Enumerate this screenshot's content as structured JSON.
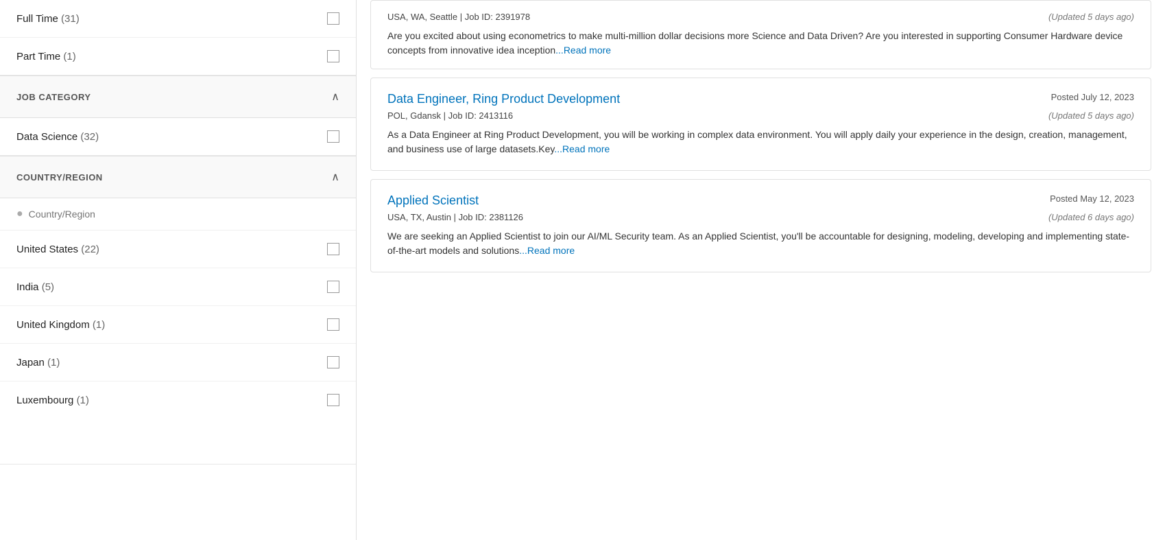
{
  "sidebar": {
    "employment_type_section": {
      "items": [
        {
          "label": "Full Time",
          "count": "(31)"
        },
        {
          "label": "Part Time",
          "count": "(1)"
        }
      ]
    },
    "job_category_section": {
      "title": "JOB CATEGORY",
      "items": [
        {
          "label": "Data Science",
          "count": "(32)"
        }
      ]
    },
    "country_region_section": {
      "title": "COUNTRY/REGION",
      "search_placeholder": "Country/Region",
      "items": [
        {
          "label": "United States",
          "count": "(22)"
        },
        {
          "label": "India",
          "count": "(5)"
        },
        {
          "label": "United Kingdom",
          "count": "(1)"
        },
        {
          "label": "Japan",
          "count": "(1)"
        },
        {
          "label": "Luxembourg",
          "count": "(1)"
        }
      ]
    }
  },
  "jobs": {
    "partial_card": {
      "location": "USA, WA, Seattle | Job ID: 2391978",
      "updated": "(Updated 5 days ago)",
      "description": "Are you excited about using econometrics to make multi-million dollar decisions more Science and Data Driven? Are you interested in supporting Consumer Hardware device concepts from innovative idea inception",
      "read_more": "...Read more"
    },
    "cards": [
      {
        "title": "Data Engineer, Ring Product Development",
        "posted": "Posted July 12, 2023",
        "location": "POL, Gdansk | Job ID: 2413116",
        "updated": "(Updated 5 days ago)",
        "description": "As a Data Engineer at Ring Product Development, you will be working in complex data environment. You will apply daily your experience in the design, creation, management, and business use of large datasets.Key",
        "read_more": "...Read more"
      },
      {
        "title": "Applied Scientist",
        "posted": "Posted May 12, 2023",
        "location": "USA, TX, Austin | Job ID: 2381126",
        "updated": "(Updated 6 days ago)",
        "description": "We are seeking an Applied Scientist to join our AI/ML Security team. As an Applied Scientist, you'll be accountable for designing, modeling, developing and implementing state-of-the-art models and solutions",
        "read_more": "...Read more"
      }
    ]
  },
  "icons": {
    "chevron_up": "∧",
    "location_pin": "📍"
  }
}
